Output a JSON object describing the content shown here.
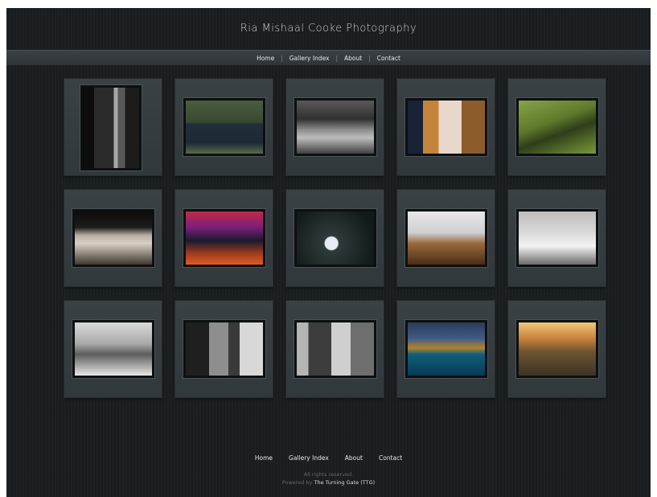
{
  "site": {
    "title": "Ria Mishaal Cooke Photography"
  },
  "nav": {
    "items": [
      "Home",
      "Gallery Index",
      "About",
      "Contact"
    ],
    "separator": "|"
  },
  "gallery": {
    "thumbs": [
      {
        "name": "woman-in-doorway",
        "orientation": "portrait",
        "bg": "linear-gradient(90deg,#0c0c0c 0 20%,#2b2b2b 20% 55%,#a7a7a7 55% 62%,#585858 62% 75%,#1c1c1c 75%)"
      },
      {
        "name": "groomsmen",
        "orientation": "landscape",
        "bg": "linear-gradient(180deg,#4b5b3e 0%,#3a4a30 40%,#1f2e3b 45%,#1d2a36 80%,#5b6b46 100%)"
      },
      {
        "name": "couple-by-columns",
        "orientation": "landscape",
        "bg": "linear-gradient(180deg,#595959 0%,#303030 35%,#8c8c8c 55%,#bdbdbd 70%,#404040 100%)"
      },
      {
        "name": "couple-kiss",
        "orientation": "landscape",
        "bg": "linear-gradient(90deg,#1a2236 0 20%,#c48439 20% 40%,#e8d7cb 40% 70%,#8c5c2a 70%)"
      },
      {
        "name": "couple-in-field",
        "orientation": "landscape",
        "bg": "linear-gradient(160deg,#89a34a 0%,#5f7a2b 40%,#2e3e1a 60%,#7a9a3a 100%)"
      },
      {
        "name": "horses",
        "orientation": "landscape",
        "bg": "linear-gradient(180deg,#0c0c0c 0%,#1c1c1c 30%,#b9b0a2 45%,#d7d0c4 60%,#403830 100%)"
      },
      {
        "name": "reception-dance",
        "orientation": "landscape",
        "bg": "linear-gradient(180deg,#c02a4a 0%,#7a1f7a 30%,#1a1a2e 55%,#a23e1c 80%,#e05a22 100%)"
      },
      {
        "name": "bride-twirl",
        "orientation": "landscape",
        "bg": "radial-gradient(circle at 45% 60%,#e6ecf4 0 12%,#2e3b3a 14%,#121a1a 80%)"
      },
      {
        "name": "under-sheet",
        "orientation": "landscape",
        "bg": "linear-gradient(180deg,#e8e8ea 0%,#cfcfd2 40%,#9a6a3c 60%,#4a2c18 100%)"
      },
      {
        "name": "snow-tree",
        "orientation": "landscape",
        "bg": "linear-gradient(180deg,#bdbdbd 0%,#d9d9d9 40%,#f3f3f3 65%,#6a6a6a 100%)"
      },
      {
        "name": "winter-trees-couple",
        "orientation": "landscape",
        "bg": "linear-gradient(180deg,#dadada 0%,#a9a9a9 40%,#5c5c5c 60%,#e7e7e7 100%)"
      },
      {
        "name": "couple-closeup",
        "orientation": "landscape",
        "bg": "linear-gradient(90deg,#1f1f1f 0 30%,#8e8e8e 30% 55%,#3a3a3a 55% 70%,#d8d8d8 70%)"
      },
      {
        "name": "couple-smile",
        "orientation": "landscape",
        "bg": "linear-gradient(90deg,#b5b5b5 0 15%,#3d3d3d 15% 45%,#cfcfcf 45% 70%,#6e6e6e 70%)"
      },
      {
        "name": "sunset-lake",
        "orientation": "landscape",
        "bg": "linear-gradient(180deg,#2c3c58 0%,#3f5a86 30%,#b2832c 48%,#0f5f7c 60%,#083a56 100%)"
      },
      {
        "name": "sunset-couple",
        "orientation": "landscape",
        "bg": "linear-gradient(180deg,#f0c87a 0%,#c9813a 30%,#6e5432 55%,#3a3424 100%)"
      }
    ]
  },
  "footer": {
    "nav": [
      "Home",
      "Gallery Index",
      "About",
      "Contact"
    ],
    "copyright": "All rights reserved.",
    "powered_prefix": "Powered by",
    "powered_link": "The Turning Gate (TTG)"
  }
}
